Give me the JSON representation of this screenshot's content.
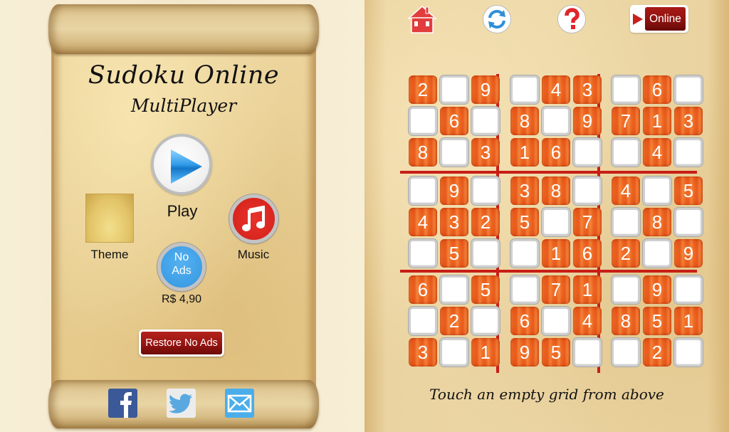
{
  "menu_screen": {
    "title": "Sudoku Online",
    "subtitle": "MultiPlayer",
    "play": {
      "icon": "play-icon",
      "label": "Play"
    },
    "theme": {
      "label": "Theme"
    },
    "music": {
      "icon": "music-note-icon",
      "label": "Music"
    },
    "no_ads": {
      "line1": "No",
      "line2": "Ads",
      "price": "R$ 4,90"
    },
    "restore_button": "Restore No Ads",
    "social": [
      {
        "name": "facebook",
        "icon": "facebook-icon",
        "color": "#3b5998"
      },
      {
        "name": "twitter",
        "icon": "twitter-icon",
        "color": "#5aa8e0"
      },
      {
        "name": "email",
        "icon": "mail-icon",
        "color": "#4aaeea"
      }
    ]
  },
  "game_screen": {
    "toolbar": [
      {
        "name": "home",
        "icon": "home-icon"
      },
      {
        "name": "refresh",
        "icon": "refresh-icon"
      },
      {
        "name": "help",
        "icon": "help-icon"
      }
    ],
    "online_button": "Online",
    "hint": "Touch an empty grid from above",
    "colors": {
      "given_cell": "#ea5c1c",
      "separator": "#c81e16"
    },
    "board": [
      [
        2,
        0,
        9,
        0,
        4,
        3,
        0,
        6,
        0
      ],
      [
        0,
        6,
        0,
        8,
        0,
        9,
        7,
        1,
        3
      ],
      [
        8,
        0,
        3,
        1,
        6,
        0,
        0,
        4,
        0
      ],
      [
        0,
        9,
        0,
        3,
        8,
        0,
        4,
        0,
        5
      ],
      [
        4,
        3,
        2,
        5,
        0,
        7,
        0,
        8,
        0
      ],
      [
        0,
        5,
        0,
        0,
        1,
        6,
        2,
        0,
        9
      ],
      [
        6,
        0,
        5,
        0,
        7,
        1,
        0,
        9,
        0
      ],
      [
        0,
        2,
        0,
        6,
        0,
        4,
        8,
        5,
        1
      ],
      [
        3,
        0,
        1,
        9,
        5,
        0,
        0,
        2,
        0
      ]
    ]
  }
}
